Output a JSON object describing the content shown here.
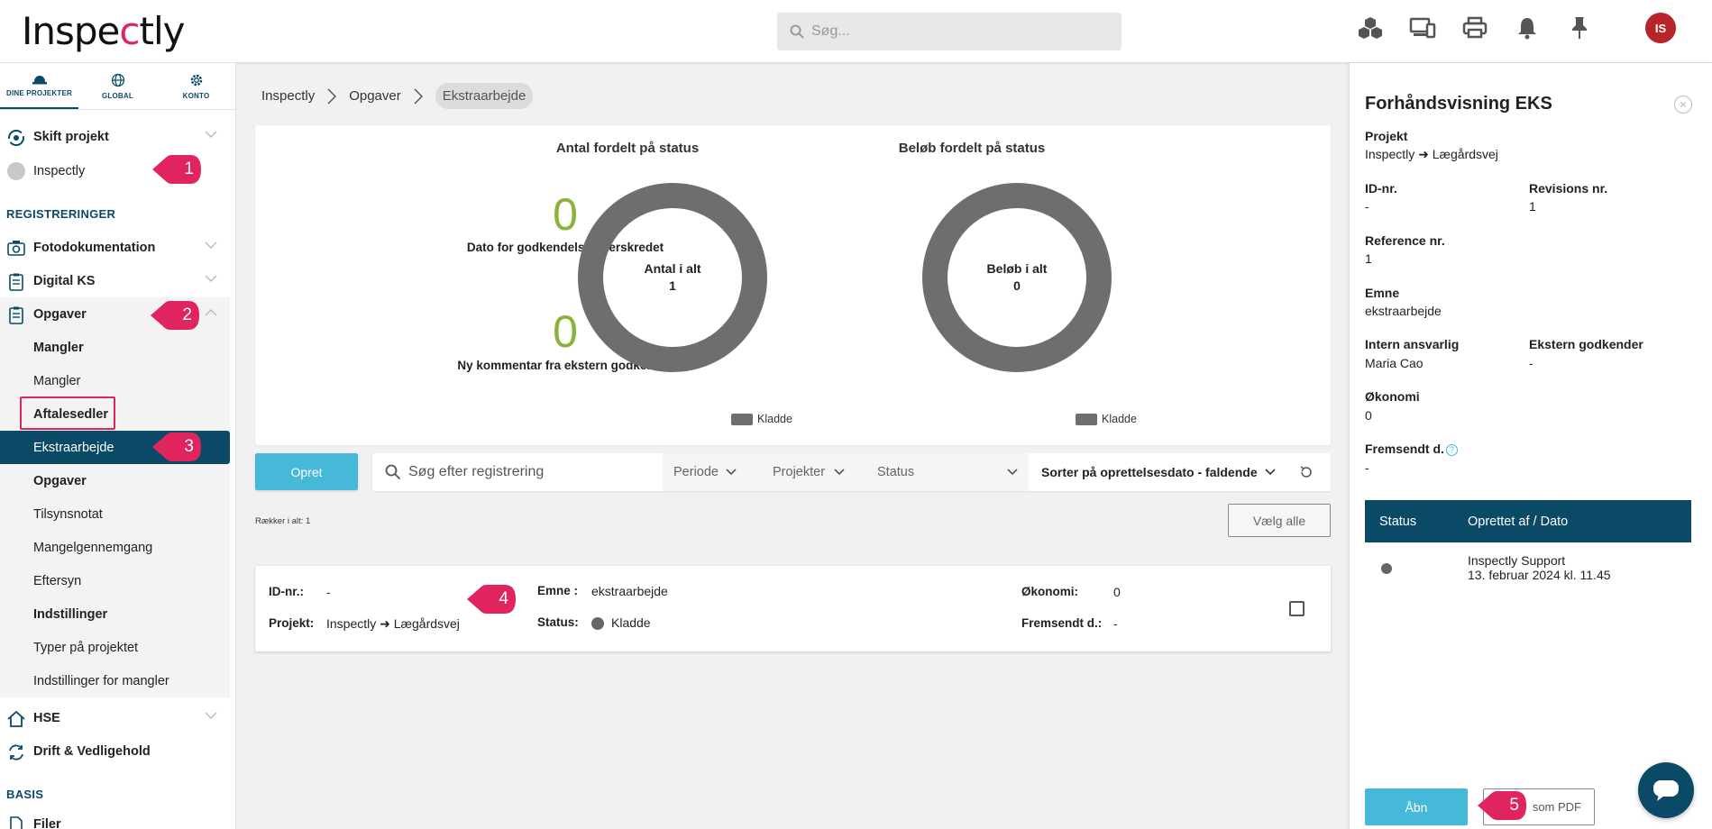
{
  "app": {
    "logo_text": "Inspectly",
    "brand_color": "#e0245e",
    "primary_color": "#0b4a66",
    "accent_color": "#46b8d8",
    "green": "#8ab33a"
  },
  "header": {
    "search_placeholder": "Søg...",
    "icons": [
      "cubes-icon",
      "devices-icon",
      "print-icon",
      "bell-icon",
      "pin-icon"
    ],
    "avatar_initials": "IS"
  },
  "sidebar": {
    "tabs": [
      {
        "label": "DINE PROJEKTER",
        "icon": "hardhat-icon"
      },
      {
        "label": "GLOBAL",
        "icon": "globe-icon"
      },
      {
        "label": "KONTO",
        "icon": "gear-icon"
      }
    ],
    "switch_project": "Skift projekt",
    "current_project": "Inspectly",
    "section_registreringer": "REGISTRERINGER",
    "items": {
      "fotodokumentation": "Fotodokumentation",
      "digital_ks": "Digital KS",
      "opgaver": "Opgaver",
      "mangler_head": "Mangler",
      "mangler": "Mangler",
      "aftalesedler": "Aftalesedler",
      "ekstraarbejde": "Ekstraarbejde",
      "opgaver_head": "Opgaver",
      "tilsynsnotat": "Tilsynsnotat",
      "mangelgennemgang": "Mangelgennemgang",
      "eftersyn": "Eftersyn",
      "indstillinger_head": "Indstillinger",
      "typer": "Typer på projektet",
      "indstillinger_mangler": "Indstillinger for mangler",
      "hse": "HSE",
      "drift": "Drift & Vedligehold"
    },
    "section_basis": "BASIS",
    "filer": "Filer"
  },
  "markers": [
    "1",
    "2",
    "3",
    "4",
    "5"
  ],
  "breadcrumb": [
    "Inspectly",
    "Opgaver",
    "Ekstraarbejde"
  ],
  "stats": {
    "overdue_count": "0",
    "overdue_label": "Dato for godkendelse overskredet",
    "comment_count": "0",
    "comment_label": "Ny kommentar fra ekstern godkender"
  },
  "chart_data": [
    {
      "type": "pie",
      "title": "Antal fordelt på status",
      "center_label": "Antal i alt",
      "center_value": "1",
      "categories": [
        "Kladde"
      ],
      "values": [
        1
      ],
      "colors": [
        "#6e6e6e"
      ]
    },
    {
      "type": "pie",
      "title": "Beløb fordelt på status",
      "center_label": "Beløb i alt",
      "center_value": "0",
      "categories": [
        "Kladde"
      ],
      "values": [
        0
      ],
      "colors": [
        "#6e6e6e"
      ]
    }
  ],
  "toolbar": {
    "create_label": "Opret",
    "search_placeholder": "Søg efter registrering",
    "filter_periode": "Periode",
    "filter_projekter": "Projekter",
    "filter_status": "Status",
    "sort_label": "Sorter på oprettelsesdato - faldende",
    "row_count": "Rækker i alt: 1",
    "select_all": "Vælg alle"
  },
  "registration": {
    "id_label": "ID-nr.:",
    "id_value": "-",
    "project_label": "Projekt:",
    "project_value": "Inspectly ➜ Lægårdsvej",
    "subject_label": "Emne :",
    "subject_value": "ekstraarbejde",
    "status_label": "Status:",
    "status_value": "Kladde",
    "economy_label": "Økonomi:",
    "economy_value": "0",
    "sent_label": "Fremsendt d.:",
    "sent_value": "-"
  },
  "preview": {
    "title": "Forhåndsvisning EKS",
    "project_label": "Projekt",
    "project_value": "Inspectly ➜ Lægårdsvej",
    "id_label": "ID-nr.",
    "id_value": "-",
    "revision_label": "Revisions nr.",
    "revision_value": "1",
    "reference_label": "Reference nr.",
    "reference_value": "1",
    "subject_label": "Emne",
    "subject_value": "ekstraarbejde",
    "internal_label": "Intern ansvarlig",
    "internal_value": "Maria Cao",
    "external_label": "Ekstern godkender",
    "external_value": "-",
    "economy_label": "Økonomi",
    "economy_value": "0",
    "sent_label": "Fremsendt d.",
    "sent_value": "-",
    "table_headers": [
      "Status",
      "Oprettet af / Dato"
    ],
    "table_row": {
      "by": "Inspectly Support",
      "date": "13. februar 2024 kl. 11.45"
    },
    "open_label": "Åbn",
    "pdf_label": "som PDF"
  }
}
